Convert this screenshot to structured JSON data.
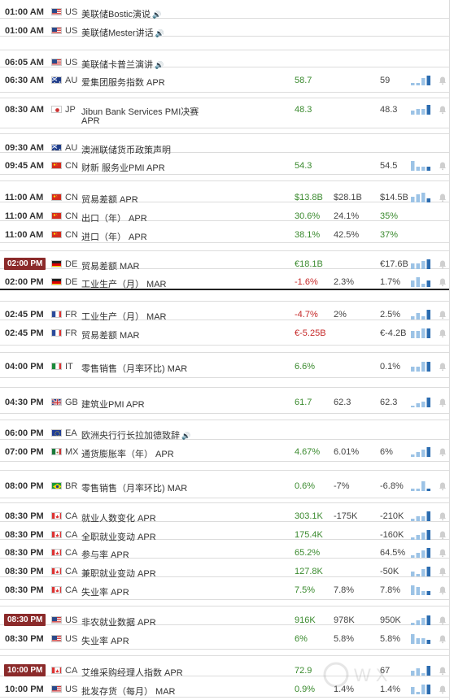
{
  "colors": {
    "up": "#3a8a2e",
    "down": "#c62828",
    "badge": "#8b2a2a",
    "bar": "#2b6cb0",
    "bar_light": "#9cc3e6",
    "bar_orange": "#f0c060"
  },
  "events": [
    {
      "time": "01:00 AM",
      "country": "US",
      "flag": "us",
      "title": "美联储Bostic演说",
      "speech": true
    },
    {
      "time": "01:00 AM",
      "country": "US",
      "flag": "us",
      "title": "美联储Mester讲话",
      "speech": true
    },
    {
      "time": "06:05 AM",
      "country": "US",
      "flag": "us",
      "title": "美联储卡普兰演讲",
      "speech": true
    },
    {
      "time": "06:30 AM",
      "country": "AU",
      "flag": "au",
      "title": "爱集团服务指数 APR",
      "actual": "58.7",
      "actual_color": "g",
      "forecast": "",
      "previous": "59",
      "spark": [
        1,
        1,
        3,
        4
      ]
    },
    {
      "time": "08:30 AM",
      "country": "JP",
      "flag": "jp",
      "title": "Jibun Bank Services PMI决赛",
      "title2": "APR",
      "actual": "48.3",
      "actual_color": "g",
      "forecast": "",
      "previous": "48.3",
      "spark": [
        2,
        3,
        3,
        5
      ]
    },
    {
      "time": "09:30 AM",
      "country": "AU",
      "flag": "au",
      "title": "澳洲联储货币政策声明"
    },
    {
      "time": "09:45 AM",
      "country": "CN",
      "flag": "cn",
      "title": "财新 服务业PMI APR",
      "actual": "54.3",
      "actual_color": "g",
      "forecast": "",
      "previous": "54.5",
      "spark": [
        5,
        2,
        2,
        2
      ]
    },
    {
      "time": "11:00 AM",
      "country": "CN",
      "flag": "cn",
      "title": "贸易差额 APR",
      "actual": "$13.8B",
      "actual_color": "g",
      "forecast": "$28.1B",
      "previous": "$14.5B",
      "spark": [
        3,
        4,
        5,
        2
      ]
    },
    {
      "time": "11:00 AM",
      "country": "CN",
      "flag": "cn",
      "title": "出口（年） APR",
      "actual": "30.6%",
      "actual_color": "g",
      "forecast": "24.1%",
      "previous": "35%",
      "previous_color": "g"
    },
    {
      "time": "11:00 AM",
      "country": "CN",
      "flag": "cn",
      "title": "进口（年） APR",
      "actual": "38.1%",
      "actual_color": "g",
      "forecast": "42.5%",
      "previous": "37%",
      "previous_color": "g"
    },
    {
      "time": "02:00 PM",
      "country": "DE",
      "flag": "de",
      "title": "贸易差额 MAR",
      "actual": "€18.1B",
      "actual_color": "g",
      "forecast": "",
      "previous": "€17.6B",
      "spark": [
        3,
        3,
        4,
        5
      ],
      "badge": true
    },
    {
      "time": "02:00 PM",
      "country": "DE",
      "flag": "de",
      "title": "工业生产（月） MAR",
      "actual": "-1.6%",
      "actual_color": "r",
      "forecast": "2.3%",
      "previous": "1.7%",
      "spark": [
        2,
        3,
        1,
        2
      ]
    },
    {
      "time": "02:45 PM",
      "country": "FR",
      "flag": "fr",
      "title": "工业生产（月） MAR",
      "actual": "-4.7%",
      "actual_color": "r",
      "forecast": "2%",
      "previous": "2.5%",
      "spark": [
        1,
        2,
        1,
        3
      ]
    },
    {
      "time": "02:45 PM",
      "country": "FR",
      "flag": "fr",
      "title": "贸易差额 MAR",
      "actual": "€-5.25B",
      "actual_color": "r",
      "forecast": "",
      "previous": "€-4.2B",
      "spark": [
        3,
        3,
        4,
        4
      ]
    },
    {
      "time": "04:00 PM",
      "country": "IT",
      "flag": "it",
      "title": "零售销售（月率环比) MAR",
      "actual": "6.6%",
      "actual_color": "g",
      "forecast": "",
      "previous": "0.1%",
      "spark": [
        1,
        1,
        2,
        2
      ]
    },
    {
      "time": "04:30 PM",
      "country": "GB",
      "flag": "gb",
      "title": "建筑业PMI APR",
      "actual": "61.7",
      "actual_color": "g",
      "forecast": "62.3",
      "previous": "62.3",
      "spark": [
        1,
        2,
        3,
        5
      ]
    },
    {
      "time": "06:00 PM",
      "country": "EA",
      "flag": "eu",
      "title": "欧洲央行行长拉加德致辞",
      "speech": true
    },
    {
      "time": "07:00 PM",
      "country": "MX",
      "flag": "mx",
      "title": "通货膨胀率（年） APR",
      "actual": "4.67%",
      "actual_color": "g",
      "forecast": "6.01%",
      "previous": "6%",
      "spark": [
        1,
        2,
        3,
        4
      ]
    },
    {
      "time": "08:00 PM",
      "country": "BR",
      "flag": "br",
      "title": "零售销售（月率环比) MAR",
      "actual": "0.6%",
      "actual_color": "g",
      "forecast": "-7%",
      "previous": "-6.8%",
      "spark": [
        1,
        1,
        4,
        1
      ]
    },
    {
      "time": "08:30 PM",
      "country": "CA",
      "flag": "ca",
      "title": "就业人数变化 APR",
      "actual": "303.1K",
      "actual_color": "g",
      "forecast": "-175K",
      "previous": "-210K",
      "spark": [
        1,
        2,
        2,
        4
      ]
    },
    {
      "time": "08:30 PM",
      "country": "CA",
      "flag": "ca",
      "title": "全职就业变动 APR",
      "actual": "175.4K",
      "actual_color": "g",
      "forecast": "",
      "previous": "-160K",
      "spark": [
        1,
        2,
        3,
        4
      ]
    },
    {
      "time": "08:30 PM",
      "country": "CA",
      "flag": "ca",
      "title": "参与率 APR",
      "actual": "65.2%",
      "actual_color": "g",
      "forecast": "",
      "previous": "64.5%",
      "spark": [
        1,
        2,
        3,
        4
      ]
    },
    {
      "time": "08:30 PM",
      "country": "CA",
      "flag": "ca",
      "title": "兼职就业变动 APR",
      "actual": "127.8K",
      "actual_color": "g",
      "forecast": "",
      "previous": "-50K",
      "spark": [
        2,
        1,
        3,
        4
      ]
    },
    {
      "time": "08:30 PM",
      "country": "CA",
      "flag": "ca",
      "title": "失业率 APR",
      "actual": "7.5%",
      "actual_color": "g",
      "forecast": "7.8%",
      "previous": "7.8%",
      "spark": [
        5,
        4,
        2,
        2
      ]
    },
    {
      "time": "08:30 PM",
      "country": "US",
      "flag": "us",
      "title": "非农就业数据 APR",
      "actual": "916K",
      "actual_color": "g",
      "forecast": "978K",
      "previous": "950K",
      "spark": [
        1,
        2,
        3,
        4
      ],
      "badge": true
    },
    {
      "time": "08:30 PM",
      "country": "US",
      "flag": "us",
      "title": "失业率 APR",
      "actual": "6%",
      "actual_color": "g",
      "forecast": "5.8%",
      "previous": "5.8%",
      "spark": [
        5,
        3,
        3,
        2
      ]
    },
    {
      "time": "10:00 PM",
      "country": "CA",
      "flag": "ca",
      "title": "艾维采购经理人指数 APR",
      "actual": "72.9",
      "actual_color": "g",
      "forecast": "",
      "previous": "67",
      "spark": [
        2,
        3,
        1,
        4
      ],
      "badge": true
    },
    {
      "time": "10:00 PM",
      "country": "US",
      "flag": "us",
      "title": "批发存货（每月） MAR",
      "actual": "0.9%",
      "actual_color": "g",
      "forecast": "1.4%",
      "previous": "1.4%",
      "spark": [
        3,
        1,
        4,
        4
      ]
    }
  ],
  "watermark": "W X"
}
